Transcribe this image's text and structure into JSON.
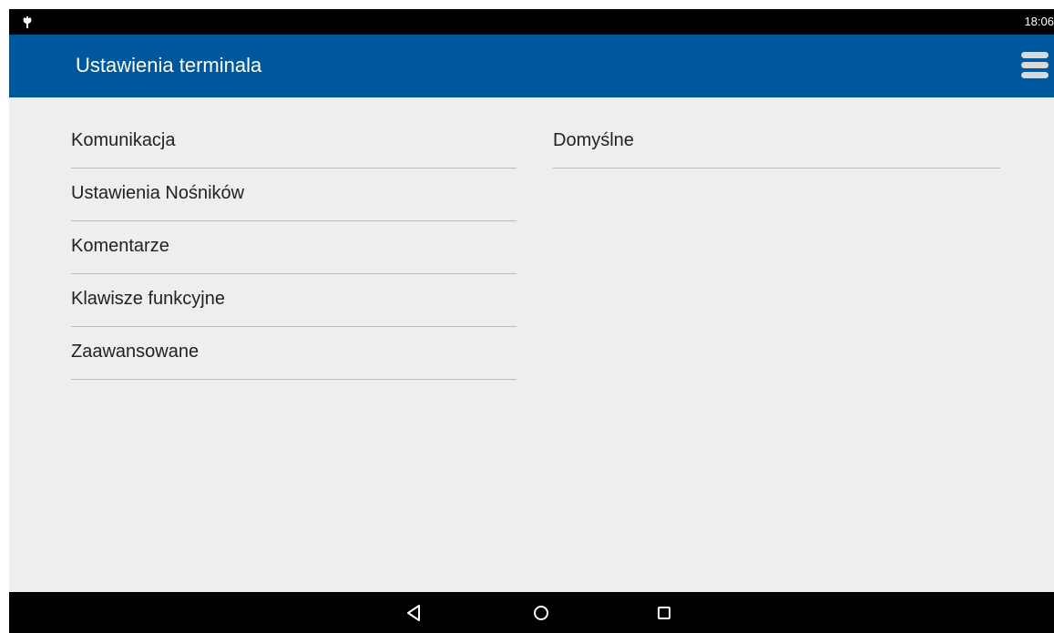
{
  "status_bar": {
    "time": "18:06",
    "icon": "notification-icon"
  },
  "app_bar": {
    "title": "Ustawienia terminala",
    "menu_icon": "hamburger-menu-icon",
    "color": "#00589c"
  },
  "settings": {
    "left_items": [
      {
        "label": "Komunikacja"
      },
      {
        "label": "Ustawienia Nośników"
      },
      {
        "label": "Komentarze"
      },
      {
        "label": "Klawisze funkcyjne"
      },
      {
        "label": "Zaawansowane"
      }
    ],
    "right_items": [
      {
        "label": "Domyślne"
      }
    ]
  },
  "nav_bar": {
    "back_icon": "back-triangle-icon",
    "home_icon": "home-circle-icon",
    "recents_icon": "recents-square-icon"
  }
}
